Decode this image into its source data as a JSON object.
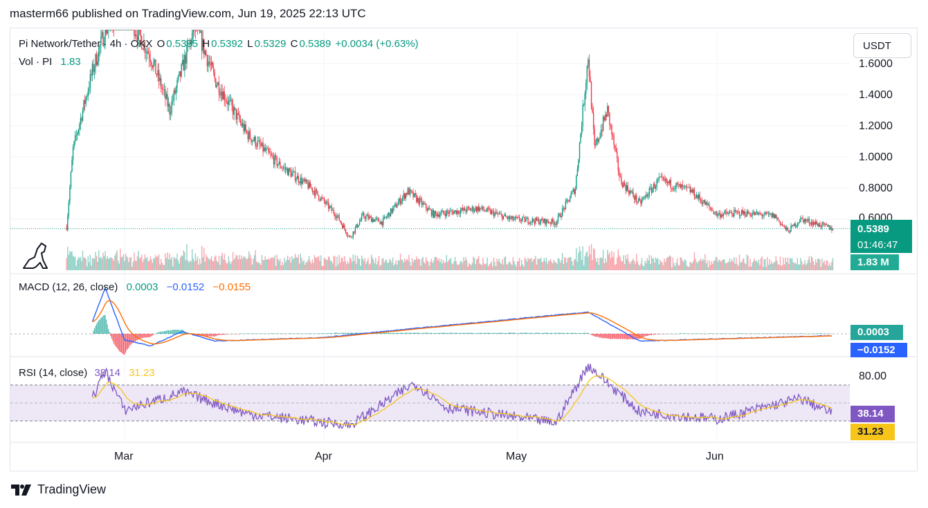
{
  "header": {
    "publish_line": "masterm66 published on TradingView.com, Jun 19, 2025 22:13 UTC"
  },
  "main_legend": {
    "symbol": "Pi Network/Tether · 4h · OKX",
    "open_label": "O",
    "open_value": "0.5355",
    "high_label": "H",
    "high_value": "0.5392",
    "low_label": "L",
    "low_value": "0.5329",
    "close_label": "C",
    "close_value": "0.5389",
    "change": "+0.0034 (+0.63%)"
  },
  "volume_legend": {
    "label": "Vol · PI",
    "value": "1.83"
  },
  "currency_button": "USDT",
  "price_axis": {
    "ticks": [
      "1.6000",
      "1.4000",
      "1.2000",
      "1.0000",
      "0.8000",
      "0.6000"
    ]
  },
  "price_tag": {
    "price": "0.5389",
    "countdown": "01:46:47",
    "volume": "1.83 M"
  },
  "macd": {
    "legend_label": "MACD (12, 26, close)",
    "histogram_value": "0.0003",
    "macd_value": "−0.0152",
    "signal_value": "−0.0155",
    "tag_hist": "0.0003",
    "tag_macd": "−0.0152"
  },
  "rsi": {
    "legend_label": "RSI (14, close)",
    "rsi_value": "38.14",
    "ma_value": "31.23",
    "axis_tick": "80.00",
    "tag_rsi": "38.14",
    "tag_ma": "31.23"
  },
  "time_axis": {
    "months": [
      "Mar",
      "Apr",
      "May",
      "Jun"
    ]
  },
  "footer": {
    "brand": "TradingView"
  },
  "colors": {
    "up": "#089981",
    "down": "#f23645",
    "macd": "#2962ff",
    "signal": "#ff6d00",
    "rsi": "#7e57c2",
    "rsi_ma": "#f7c51a",
    "rsi_band": "#ede7f6"
  },
  "chart_data": [
    {
      "type": "candlestick",
      "title": "Pi Network/Tether · 4h · OKX",
      "x_axis_months": [
        "Mar",
        "Apr",
        "May",
        "Jun"
      ],
      "ylim": [
        0.4,
        1.75
      ],
      "y_ticks": [
        0.6,
        0.8,
        1.0,
        1.2,
        1.4,
        1.6
      ],
      "last_price": 0.5389,
      "close_approx_keypoints": [
        {
          "date": "Feb 20",
          "close": 0.55
        },
        {
          "date": "Feb 21",
          "close": 1.05
        },
        {
          "date": "Feb 24",
          "close": 1.55
        },
        {
          "date": "Feb 26",
          "close": 1.82
        },
        {
          "date": "Mar 1",
          "close": 1.95
        },
        {
          "date": "Mar 5",
          "close": 1.65
        },
        {
          "date": "Mar 8",
          "close": 1.3
        },
        {
          "date": "Mar 12",
          "close": 1.85
        },
        {
          "date": "Mar 15",
          "close": 1.5
        },
        {
          "date": "Mar 20",
          "close": 1.15
        },
        {
          "date": "Mar 25",
          "close": 0.95
        },
        {
          "date": "Mar 30",
          "close": 0.8
        },
        {
          "date": "Apr 3",
          "close": 0.62
        },
        {
          "date": "Apr 5",
          "close": 0.48
        },
        {
          "date": "Apr 7",
          "close": 0.62
        },
        {
          "date": "Apr 10",
          "close": 0.58
        },
        {
          "date": "Apr 14",
          "close": 0.78
        },
        {
          "date": "Apr 18",
          "close": 0.63
        },
        {
          "date": "Apr 25",
          "close": 0.67
        },
        {
          "date": "Apr 30",
          "close": 0.6
        },
        {
          "date": "May 7",
          "close": 0.58
        },
        {
          "date": "May 10",
          "close": 0.8
        },
        {
          "date": "May 12",
          "close": 1.65
        },
        {
          "date": "May 13",
          "close": 1.05
        },
        {
          "date": "May 15",
          "close": 1.3
        },
        {
          "date": "May 17",
          "close": 0.85
        },
        {
          "date": "May 20",
          "close": 0.7
        },
        {
          "date": "May 23",
          "close": 0.85
        },
        {
          "date": "May 28",
          "close": 0.78
        },
        {
          "date": "Jun 1",
          "close": 0.63
        },
        {
          "date": "Jun 5",
          "close": 0.64
        },
        {
          "date": "Jun 10",
          "close": 0.62
        },
        {
          "date": "Jun 12",
          "close": 0.52
        },
        {
          "date": "Jun 14",
          "close": 0.6
        },
        {
          "date": "Jun 19",
          "close": 0.5389
        }
      ]
    },
    {
      "type": "bar",
      "title": "Vol · PI",
      "last_value": "1.83 M"
    },
    {
      "type": "line",
      "title": "MACD (12, 26, close)",
      "series": [
        {
          "name": "Histogram",
          "last_value": 0.0003
        },
        {
          "name": "MACD",
          "last_value": -0.0152
        },
        {
          "name": "Signal",
          "last_value": -0.0155
        }
      ],
      "approx_keypoints_macd": [
        {
          "date": "Feb 24",
          "value": 0.1
        },
        {
          "date": "Feb 26",
          "value": 0.38
        },
        {
          "date": "Mar 1",
          "value": -0.05
        },
        {
          "date": "Mar 5",
          "value": -0.1
        },
        {
          "date": "Mar 10",
          "value": 0.02
        },
        {
          "date": "Mar 15",
          "value": -0.06
        },
        {
          "date": "Apr 1",
          "value": -0.03
        },
        {
          "date": "Apr 14",
          "value": 0.04
        },
        {
          "date": "May 12",
          "value": 0.18
        },
        {
          "date": "May 20",
          "value": -0.06
        },
        {
          "date": "Jun 19",
          "value": -0.0152
        }
      ]
    },
    {
      "type": "line",
      "title": "RSI (14, close)",
      "ylim": [
        20,
        95
      ],
      "bands": [
        30,
        70
      ],
      "y_ticks": [
        80
      ],
      "series": [
        {
          "name": "RSI",
          "last_value": 38.14
        },
        {
          "name": "RSI-based MA",
          "last_value": 31.23
        }
      ],
      "approx_keypoints_rsi": [
        {
          "date": "Feb 24",
          "value": 55
        },
        {
          "date": "Feb 26",
          "value": 86
        },
        {
          "date": "Mar 1",
          "value": 42
        },
        {
          "date": "Mar 10",
          "value": 62
        },
        {
          "date": "Mar 20",
          "value": 38
        },
        {
          "date": "Apr 5",
          "value": 25
        },
        {
          "date": "Apr 15",
          "value": 72
        },
        {
          "date": "Apr 20",
          "value": 45
        },
        {
          "date": "May 7",
          "value": 28
        },
        {
          "date": "May 12",
          "value": 92
        },
        {
          "date": "May 20",
          "value": 40
        },
        {
          "date": "Jun 1",
          "value": 32
        },
        {
          "date": "Jun 14",
          "value": 55
        },
        {
          "date": "Jun 19",
          "value": 38.14
        }
      ]
    }
  ]
}
